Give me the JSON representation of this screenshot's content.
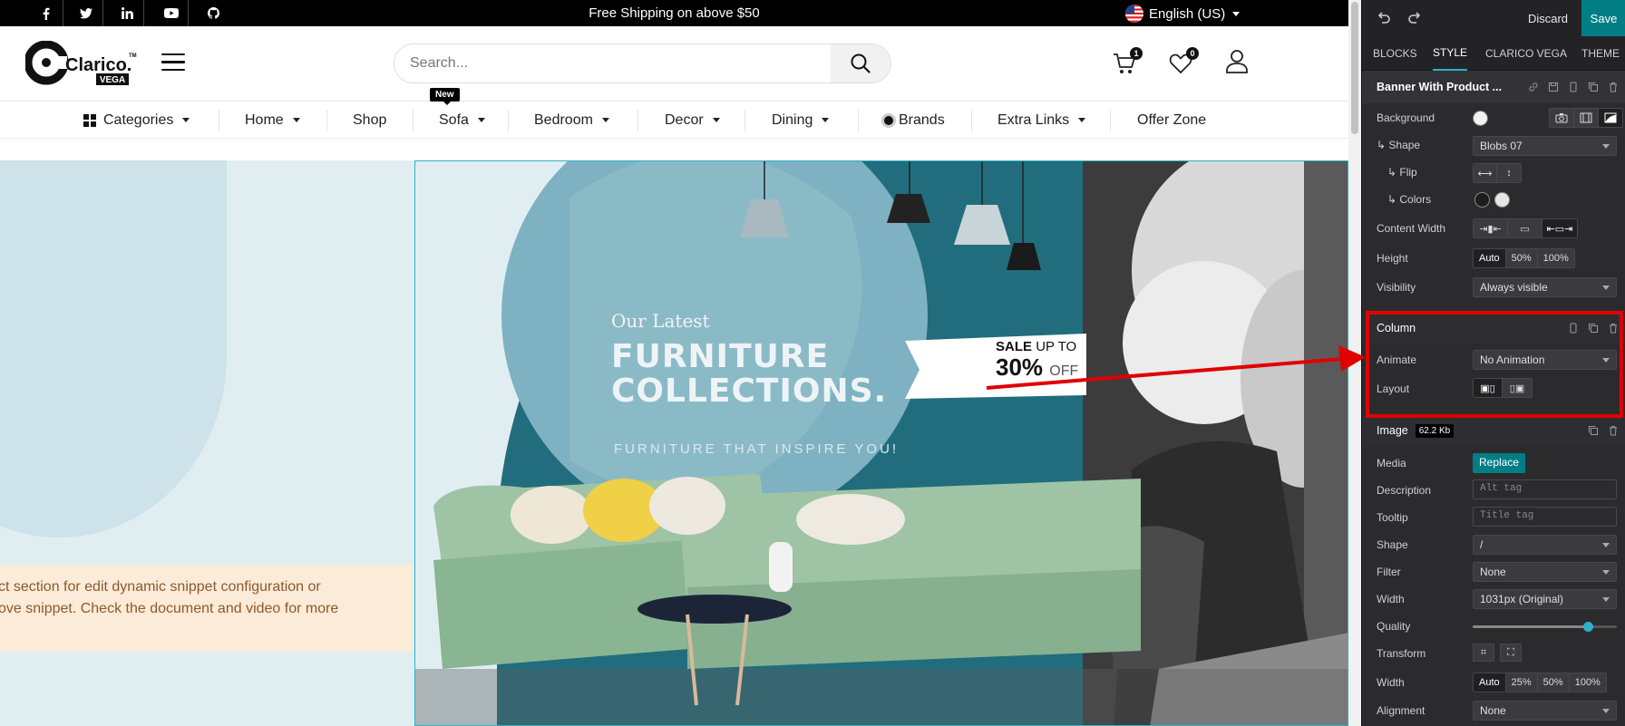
{
  "topbar": {
    "shipping_text": "Free Shipping on above $50",
    "language": "English (US)",
    "social_icons": [
      "facebook-icon",
      "twitter-icon",
      "linkedin-icon",
      "youtube-icon",
      "github-icon"
    ]
  },
  "header": {
    "logo_text": "Clarico.",
    "logo_sub": "VEGA",
    "logo_tm": "TM",
    "search_placeholder": "Search...",
    "cart_count": "1",
    "wishlist_count": "0"
  },
  "nav": {
    "new_tag": "New",
    "items": [
      {
        "label": "Categories",
        "dropdown": true
      },
      {
        "label": "Home",
        "dropdown": true
      },
      {
        "label": "Shop",
        "dropdown": false
      },
      {
        "label": "Sofa",
        "dropdown": true
      },
      {
        "label": "Bedroom",
        "dropdown": true
      },
      {
        "label": "Decor",
        "dropdown": true
      },
      {
        "label": "Dining",
        "dropdown": true
      },
      {
        "label": "Brands",
        "dropdown": false
      },
      {
        "label": "Extra Links",
        "dropdown": true
      },
      {
        "label": "Offer Zone",
        "dropdown": false
      }
    ]
  },
  "content": {
    "notice_line1": "ct section for edit dynamic snippet configuration or",
    "notice_line2": "ove snippet. Check the document and video for more"
  },
  "banner": {
    "kicker": "Our Latest",
    "title_line1": "FURNITURE",
    "title_line2": "COLLECTIONS.",
    "tagline": "FURNITURE THAT INSPIRE YOU!",
    "sale_word": "SALE",
    "sale_upto": "UP TO",
    "sale_percent": "30%",
    "sale_off": "OFF"
  },
  "editor": {
    "discard": "Discard",
    "save": "Save",
    "tabs": [
      "BLOCKS",
      "STYLE",
      "CLARICO VEGA",
      "THEME"
    ],
    "active_tab": "STYLE",
    "banner_section": {
      "title": "Banner With Product ...",
      "background_label": "Background",
      "shape_label": "Shape",
      "shape_value": "Blobs 07",
      "flip_label": "Flip",
      "colors_label": "Colors",
      "content_width_label": "Content Width",
      "height_label": "Height",
      "height_options": [
        "Auto",
        "50%",
        "100%"
      ],
      "visibility_label": "Visibility",
      "visibility_value": "Always visible"
    },
    "column_section": {
      "title": "Column",
      "animate_label": "Animate",
      "animate_value": "No Animation",
      "layout_label": "Layout"
    },
    "image_section": {
      "title": "Image",
      "size": "62.2 Kb",
      "media_label": "Media",
      "replace": "Replace",
      "description_label": "Description",
      "description_placeholder": "Alt tag",
      "tooltip_label": "Tooltip",
      "tooltip_placeholder": "Title tag",
      "shape_label": "Shape",
      "shape_value": "/",
      "filter_label": "Filter",
      "filter_value": "None",
      "width_label": "Width",
      "width_value": "1031px (Original)",
      "quality_label": "Quality",
      "quality_value": 0.8,
      "transform_label": "Transform",
      "width2_label": "Width",
      "width2_options": [
        "Auto",
        "25%",
        "50%",
        "100%"
      ],
      "alignment_label": "Alignment",
      "alignment_value": "None"
    }
  },
  "colors": {
    "accent": "#017e84",
    "highlight": "#e10000",
    "banner_teal": "#216d7d"
  }
}
